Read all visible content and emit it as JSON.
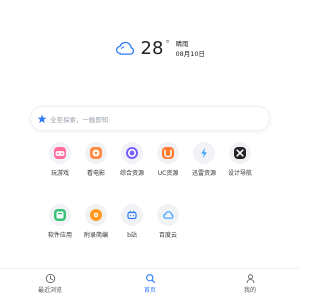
{
  "weather": {
    "temperature": "28",
    "degree_symbol": "°",
    "condition": "晴雨",
    "date": "08月10日",
    "icon": "cloud-icon"
  },
  "search": {
    "placeholder": "全至探索，一触即知",
    "logo_icon": "star-icon"
  },
  "apps": {
    "row1": [
      {
        "label": "玩游戏",
        "icon": "game-icon",
        "color": "#ff6b9a"
      },
      {
        "label": "看电影",
        "icon": "movie-icon",
        "color": "#ff8a3d"
      },
      {
        "label": "综合资源",
        "icon": "resource-icon",
        "color": "#7a5cff"
      },
      {
        "label": "UC资源",
        "icon": "uc-icon",
        "color": "#ff7a2f"
      },
      {
        "label": "迅雷资源",
        "icon": "thunder-icon",
        "color": "#3aa0ff"
      },
      {
        "label": "设计导航",
        "icon": "design-icon",
        "color": "#222222"
      }
    ],
    "row2": [
      {
        "label": "软件应用",
        "icon": "software-icon",
        "color": "#39c27a"
      },
      {
        "label": "附录简编",
        "icon": "appendix-icon",
        "color": "#ff9a1f"
      },
      {
        "label": "b站",
        "icon": "bilibili-icon",
        "color": "#2f7cf6"
      },
      {
        "label": "百度云",
        "icon": "cloud-drive-icon",
        "color": "#3aa0ff"
      }
    ]
  },
  "bottom_nav": {
    "items": [
      {
        "label": "最近浏览",
        "icon": "history-icon"
      },
      {
        "label": "首页",
        "icon": "search-icon"
      },
      {
        "label": "我的",
        "icon": "user-icon"
      }
    ],
    "active_index": 1,
    "active_color": "#2f7cf6"
  }
}
